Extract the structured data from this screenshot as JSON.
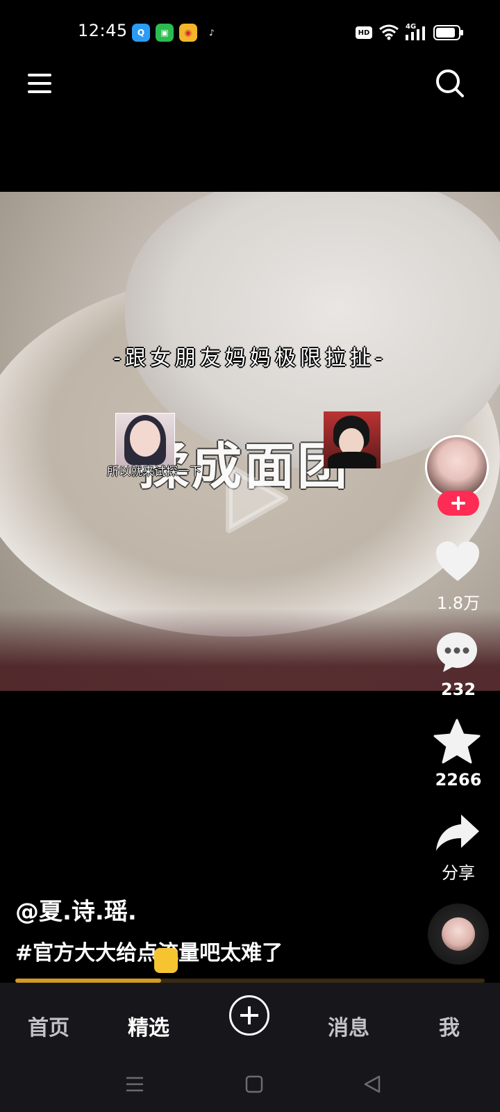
{
  "status_bar": {
    "time": "12:45",
    "apps": [
      "qq-browser-icon",
      "green-app-icon",
      "weibo-icon",
      "tiktok-icon"
    ],
    "hd_label": "HD",
    "network_label": "4G"
  },
  "video": {
    "overlay_top_text": "-跟女朋友妈妈极限拉扯-",
    "overlay_main_text": "揉成面团",
    "sticker_caption": "所以就来试探一下"
  },
  "actions": {
    "like_count": "1.8万",
    "comment_count": "232",
    "favorite_count": "2266",
    "share_label": "分享"
  },
  "caption": {
    "author": "@夏.诗.瑶.",
    "text": "#官方大大给点流量吧太难了"
  },
  "progress": {
    "fraction": 0.31
  },
  "bottom_nav": {
    "home": "首页",
    "featured": "精选",
    "inbox": "消息",
    "me": "我"
  },
  "colors": {
    "accent": "#fe2c55",
    "progress": "#d49a24",
    "nav_bg": "#17171b"
  }
}
